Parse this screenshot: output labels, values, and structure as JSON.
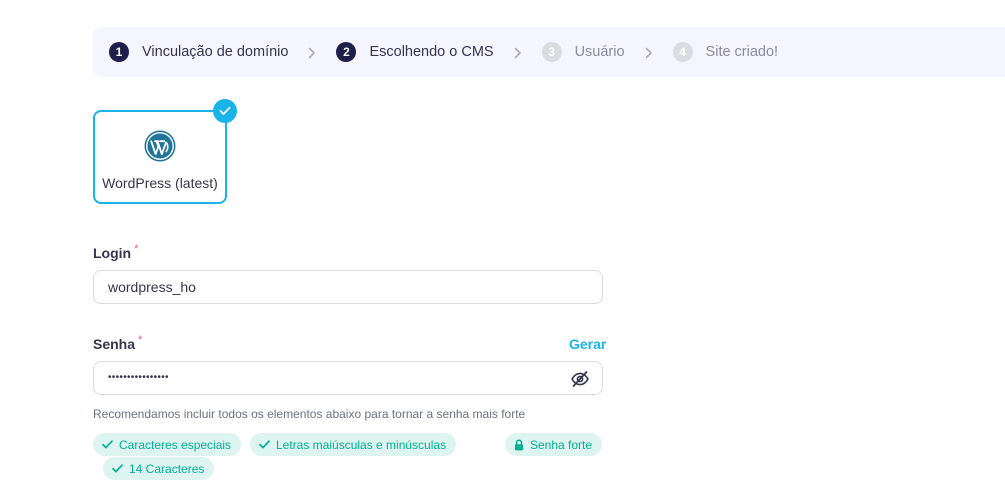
{
  "stepper": {
    "steps": [
      {
        "num": "1",
        "label": "Vinculação de domínio"
      },
      {
        "num": "2",
        "label": "Escolhendo o CMS"
      },
      {
        "num": "3",
        "label": "Usuário"
      },
      {
        "num": "4",
        "label": "Site criado!"
      }
    ],
    "active_step": 2
  },
  "cms": {
    "label": "WordPress (latest)",
    "icon": "wordpress-icon",
    "selected": true
  },
  "login": {
    "label": "Login",
    "required_mark": "*",
    "value": "wordpress_ho"
  },
  "password": {
    "label": "Senha",
    "required_mark": "*",
    "generate_label": "Gerar",
    "masked_value": "••••••••••••••••",
    "visibility_icon": "eye-slash-icon"
  },
  "hint": "Recomendamos incluir todos os elementos abaixo para tornar a senha mais forte",
  "requirements": [
    {
      "label": "Caracteres especiais",
      "icon": "check-icon"
    },
    {
      "label": "Letras maiúsculas e minúsculas",
      "icon": "check-icon"
    },
    {
      "label": "14 Caracteres",
      "icon": "check-icon"
    }
  ],
  "strength": {
    "label": "Senha forte",
    "icon": "lock-icon"
  },
  "colors": {
    "accent": "#1ab3e8",
    "success": "#00b090",
    "success_bg": "#def4f0",
    "step_active": "#1d1e4a",
    "required": "#fc5185"
  }
}
